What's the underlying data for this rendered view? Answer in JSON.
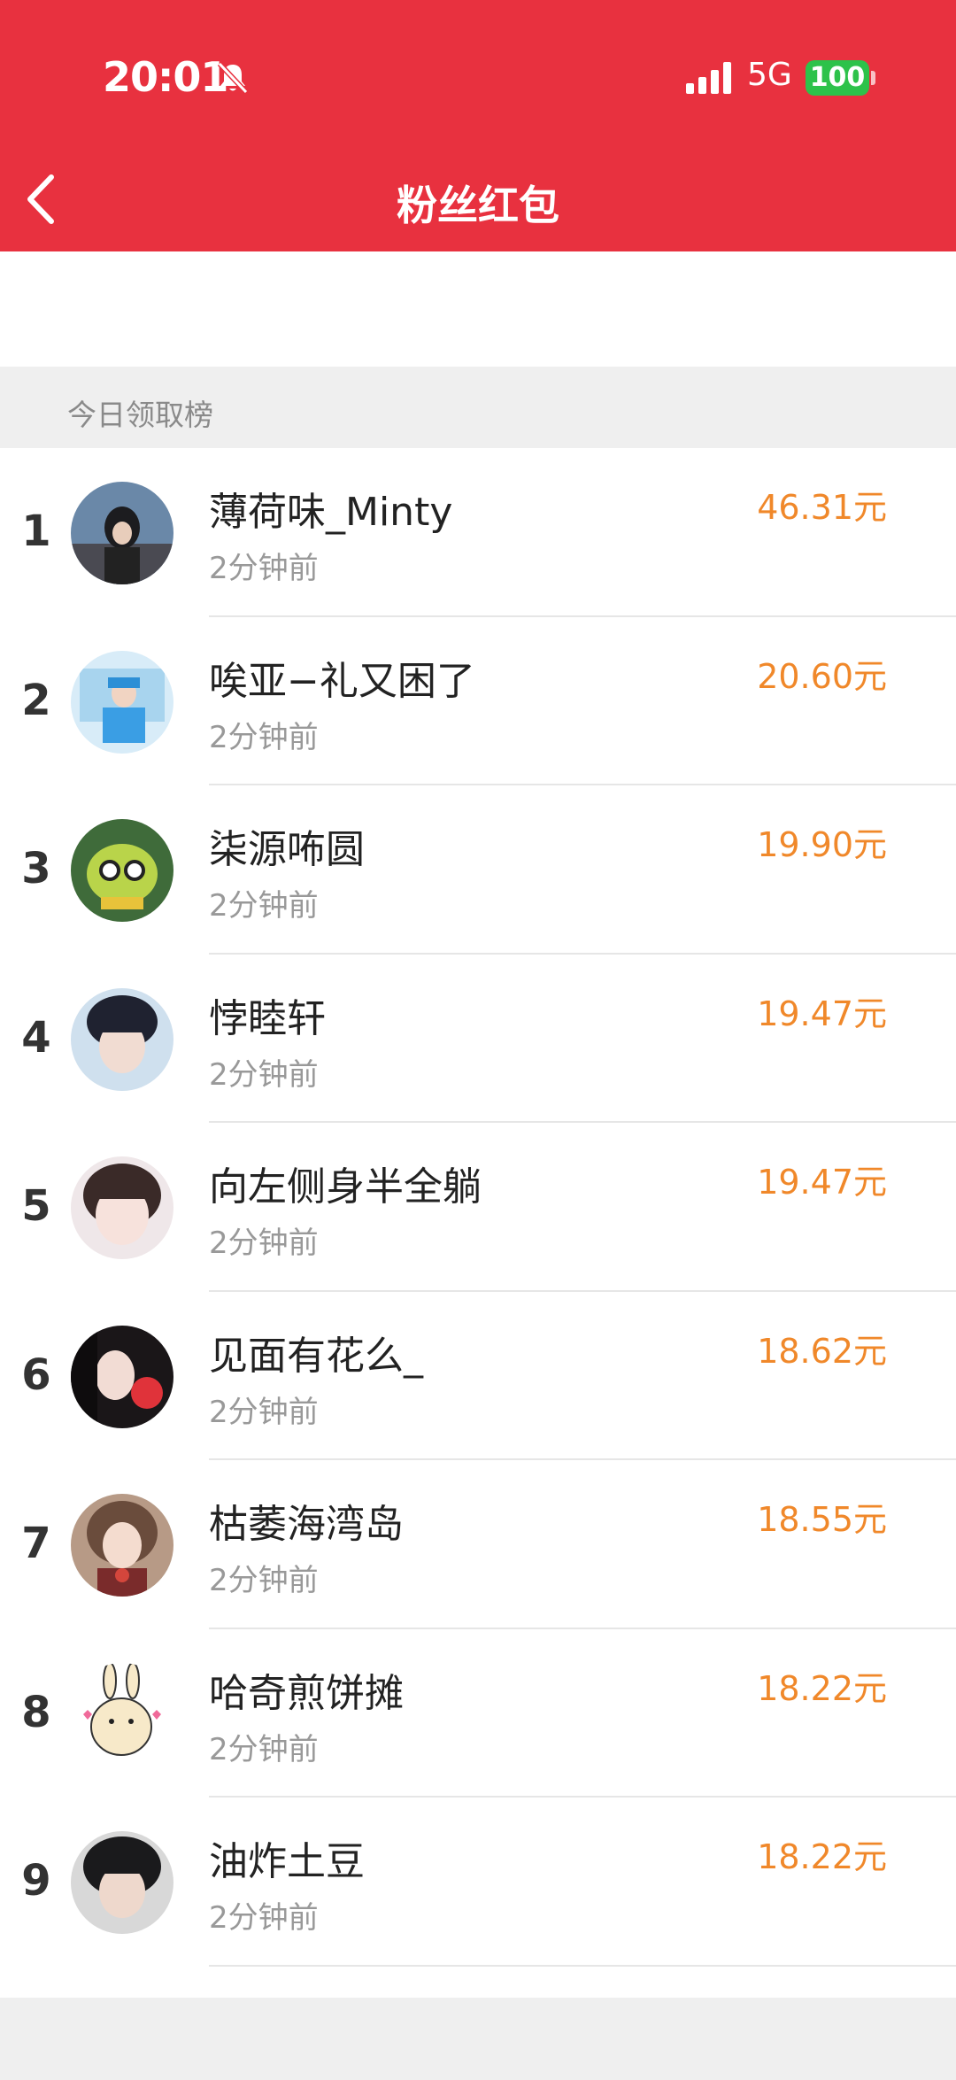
{
  "status_bar": {
    "time": "20:01",
    "network": "5G",
    "battery": "100"
  },
  "nav": {
    "title": "粉丝红包"
  },
  "section": {
    "label": "今日领取榜"
  },
  "entries": [
    {
      "rank": "1",
      "name": "薄荷味_Minty",
      "time": "2分钟前",
      "amount": "46.31元"
    },
    {
      "rank": "2",
      "name": "唉亚−礼又困了",
      "time": "2分钟前",
      "amount": "20.60元"
    },
    {
      "rank": "3",
      "name": "柒源咘圆",
      "time": "2分钟前",
      "amount": "19.90元"
    },
    {
      "rank": "4",
      "name": "悖睦轩",
      "time": "2分钟前",
      "amount": "19.47元"
    },
    {
      "rank": "5",
      "name": "向左侧身半全躺",
      "time": "2分钟前",
      "amount": "19.47元"
    },
    {
      "rank": "6",
      "name": "见面有花么_",
      "time": "2分钟前",
      "amount": "18.62元"
    },
    {
      "rank": "7",
      "name": "枯萎海湾岛",
      "time": "2分钟前",
      "amount": "18.55元"
    },
    {
      "rank": "8",
      "name": "哈奇煎饼摊",
      "time": "2分钟前",
      "amount": "18.22元"
    },
    {
      "rank": "9",
      "name": "油炸土豆",
      "time": "2分钟前",
      "amount": "18.22元"
    }
  ],
  "colors": {
    "header": "#e8313f",
    "amount": "#f0882a",
    "battery": "#2dc24a"
  }
}
